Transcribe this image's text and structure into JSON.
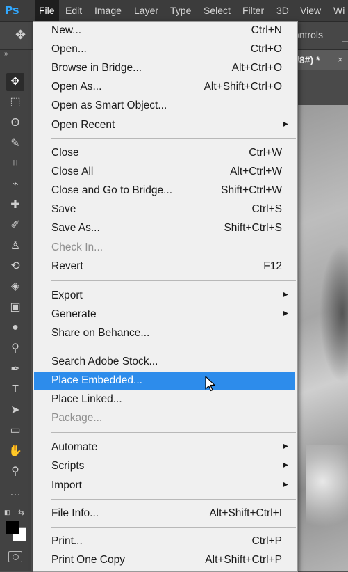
{
  "app": {
    "logo": "Ps"
  },
  "menubar": {
    "items": [
      "File",
      "Edit",
      "Image",
      "Layer",
      "Type",
      "Select",
      "Filter",
      "3D",
      "View",
      "Wi"
    ]
  },
  "options_bar": {
    "controls_text": "ontrols",
    "move_icon": "move-icon"
  },
  "document_tab": {
    "title": "/8#) *",
    "close": "×"
  },
  "toolbar": {
    "collapse": "»",
    "tools": [
      "move-tool-icon",
      "marquee-tool-icon",
      "lasso-tool-icon",
      "quick-selection-tool-icon",
      "crop-tool-icon",
      "eyedropper-tool-icon",
      "healing-brush-tool-icon",
      "brush-tool-icon",
      "clone-stamp-tool-icon",
      "history-brush-tool-icon",
      "eraser-tool-icon",
      "gradient-tool-icon",
      "blur-tool-icon",
      "dodge-tool-icon",
      "pen-tool-icon",
      "type-tool-icon",
      "path-selection-tool-icon",
      "rectangle-tool-icon",
      "hand-tool-icon",
      "zoom-tool-icon",
      "more-tools-icon"
    ],
    "foreground_color": "#000000",
    "background_color": "#ffffff"
  },
  "file_menu": {
    "hover_color": "#2d8ceb",
    "items": [
      {
        "label": "New...",
        "shortcut": "Ctrl+N"
      },
      {
        "label": "Open...",
        "shortcut": "Ctrl+O"
      },
      {
        "label": "Browse in Bridge...",
        "shortcut": "Alt+Ctrl+O"
      },
      {
        "label": "Open As...",
        "shortcut": "Alt+Shift+Ctrl+O"
      },
      {
        "label": "Open as Smart Object...",
        "shortcut": ""
      },
      {
        "label": "Open Recent",
        "shortcut": "",
        "submenu": true
      },
      {
        "label": "Close",
        "shortcut": "Ctrl+W"
      },
      {
        "label": "Close All",
        "shortcut": "Alt+Ctrl+W"
      },
      {
        "label": "Close and Go to Bridge...",
        "shortcut": "Shift+Ctrl+W"
      },
      {
        "label": "Save",
        "shortcut": "Ctrl+S"
      },
      {
        "label": "Save As...",
        "shortcut": "Shift+Ctrl+S"
      },
      {
        "label": "Check In...",
        "shortcut": "",
        "disabled": true
      },
      {
        "label": "Revert",
        "shortcut": "F12"
      },
      {
        "label": "Export",
        "shortcut": "",
        "submenu": true
      },
      {
        "label": "Generate",
        "shortcut": "",
        "submenu": true
      },
      {
        "label": "Share on Behance...",
        "shortcut": ""
      },
      {
        "label": "Search Adobe Stock...",
        "shortcut": ""
      },
      {
        "label": "Place Embedded...",
        "shortcut": "",
        "hovered": true
      },
      {
        "label": "Place Linked...",
        "shortcut": ""
      },
      {
        "label": "Package...",
        "shortcut": "",
        "disabled": true
      },
      {
        "label": "Automate",
        "shortcut": "",
        "submenu": true
      },
      {
        "label": "Scripts",
        "shortcut": "",
        "submenu": true
      },
      {
        "label": "Import",
        "shortcut": "",
        "submenu": true
      },
      {
        "label": "File Info...",
        "shortcut": "Alt+Shift+Ctrl+I"
      },
      {
        "label": "Print...",
        "shortcut": "Ctrl+P"
      },
      {
        "label": "Print One Copy",
        "shortcut": "Alt+Shift+Ctrl+P"
      }
    ]
  }
}
